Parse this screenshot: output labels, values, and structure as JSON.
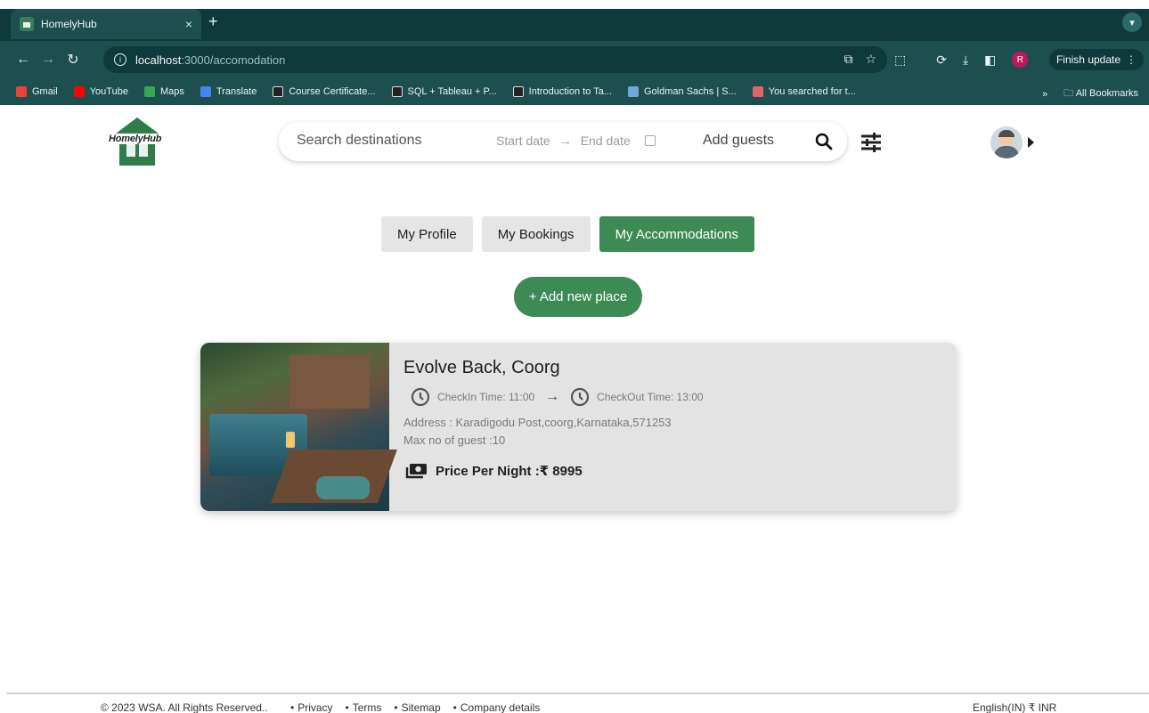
{
  "browser": {
    "tab_title": "HomelyHub",
    "tab_close": "×",
    "new_tab": "+",
    "url_host": "localhost",
    "url_path": ":3000/accomodation",
    "finish_update": "Finish update",
    "profile_initial": "R",
    "bookmarks": [
      {
        "label": "Gmail",
        "color": "#ea4335"
      },
      {
        "label": "YouTube",
        "color": "#ff0000"
      },
      {
        "label": "Maps",
        "color": "#34a853"
      },
      {
        "label": "Translate",
        "color": "#4285f4"
      },
      {
        "label": "Course Certificate...",
        "color": "#222222"
      },
      {
        "label": "SQL + Tableau + P...",
        "color": "#222222"
      },
      {
        "label": "Introduction to Ta...",
        "color": "#222222"
      },
      {
        "label": "Goldman Sachs | S...",
        "color": "#6fa8dc"
      },
      {
        "label": "You searched for t...",
        "color": "#e06666"
      }
    ],
    "bookmarks_overflow": "»",
    "all_bookmarks": "All Bookmarks"
  },
  "header": {
    "logo_text": "HomelyHub",
    "search_placeholder": "Search destinations",
    "start_date": "Start date",
    "date_arrow": "→",
    "end_date": "End date",
    "add_guests": "Add guests"
  },
  "profile_tabs": [
    {
      "label": "My Profile",
      "active": false
    },
    {
      "label": "My Bookings",
      "active": false
    },
    {
      "label": "My Accommodations",
      "active": true
    }
  ],
  "add_place_label": "+ Add new place",
  "accommodation": {
    "title": "Evolve Back, Coorg",
    "checkin": "CheckIn Time: 11:00",
    "arrow": "→",
    "checkout": "CheckOut Time: 13:00",
    "address": "Address : Karadigodu Post,coorg,Karnataka,571253",
    "max_guests": "Max no of guest :10",
    "price": "Price Per Night :₹ 8995"
  },
  "footer": {
    "copyright": "© 2023 WSA. All Rights Reserved..",
    "links": [
      "Privacy",
      "Terms",
      "Sitemap",
      "Company details"
    ],
    "locale": "English(IN) ₹ INR"
  },
  "colors": {
    "brand_green": "#3e8a55",
    "chrome_dark": "#0f3a3a",
    "chrome_toolbar": "#1e4f4f",
    "card_bg": "#e3e3e3"
  }
}
